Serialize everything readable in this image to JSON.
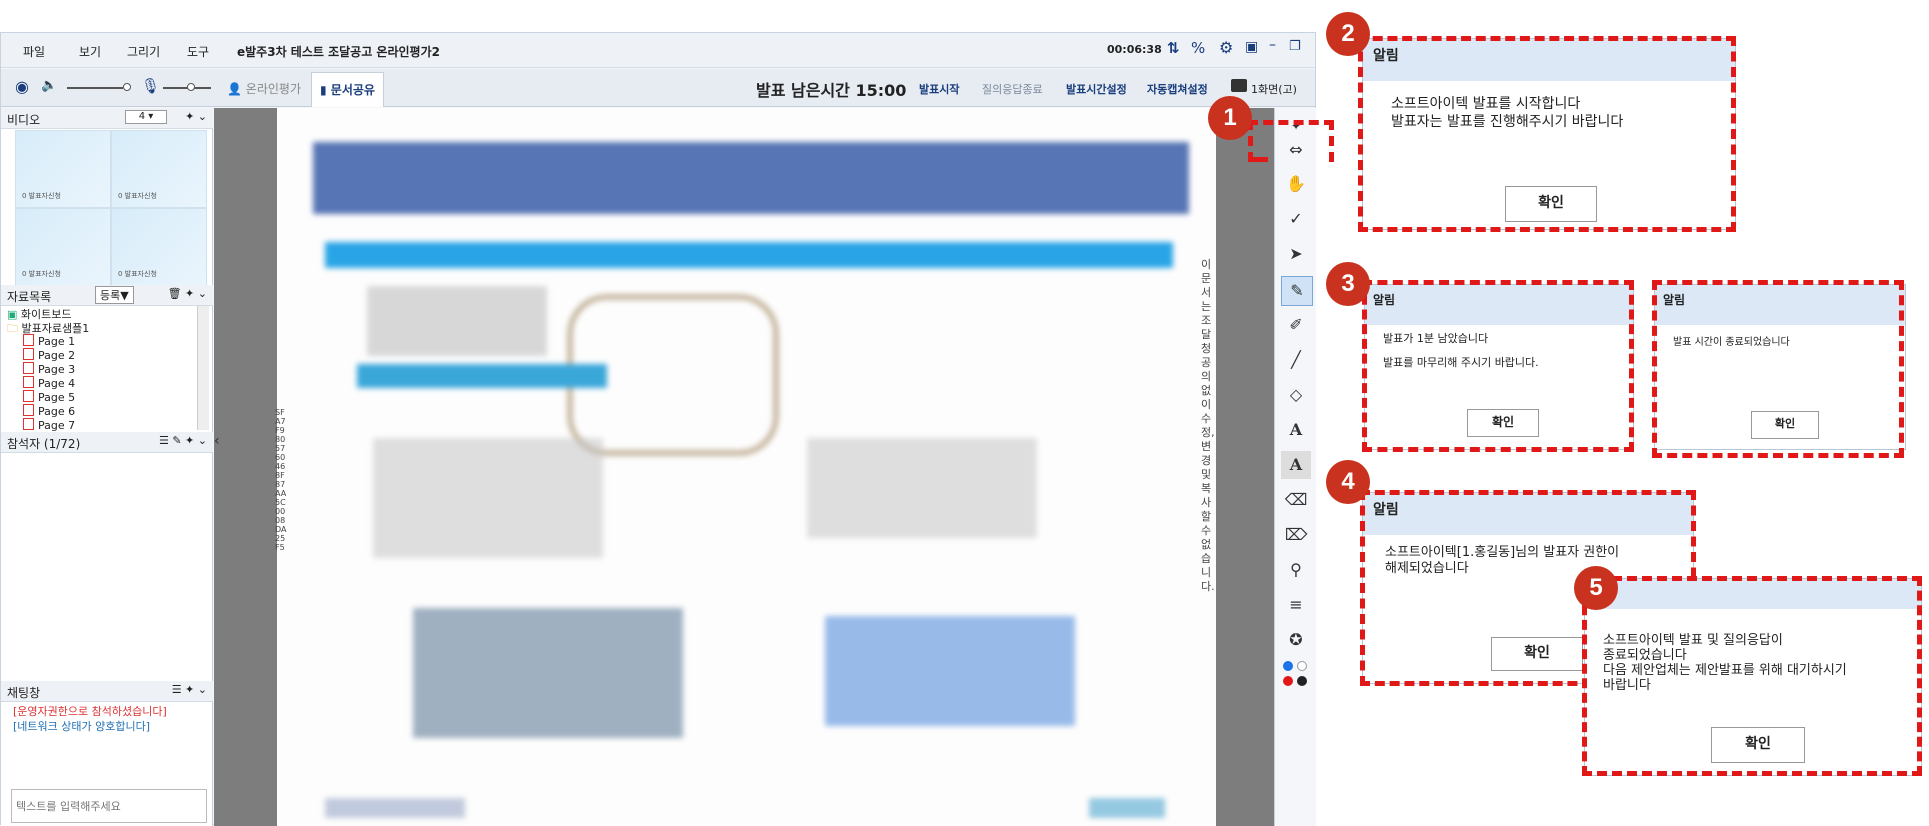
{
  "menu": {
    "file": "파일",
    "view": "보기",
    "draw": "그리기",
    "tools": "도구",
    "title": "e발주3차 테스트 조달공고 온라인평가2",
    "timer": "00:06:38"
  },
  "toolbar": {
    "tab_online": "온라인평가",
    "tab_doc": "문서공유",
    "remaining": "발표 남은시간 15:00",
    "start": "발표시작",
    "qa_end": "질의응답종료",
    "time_setting": "발표시간설정",
    "auto_capture": "자동캡쳐설정",
    "screens": "1화면(고)"
  },
  "left": {
    "video_title": "비디오",
    "video_count": "4",
    "video_cells": [
      "0 발표자신청",
      "0 발표자신청",
      "0 발표자신청",
      "0 발표자신청"
    ],
    "materials_title": "자료목록",
    "register": "등록▼",
    "tree": [
      "화이트보드",
      "발표자료샘플1",
      "Page 1",
      "Page 2",
      "Page 3",
      "Page 4",
      "Page 5",
      "Page 6",
      "Page 7"
    ],
    "participants_title": "참석자 (1/72)",
    "chat_title": "채팅창",
    "chat_lines": [
      "[운영자권한으로 참석하셨습니다]",
      "[네트워크 상태가 양호합니다]"
    ],
    "chat_placeholder": "텍스트를 입력해주세요"
  },
  "doc": {
    "side_code": "SFA7F9805760468F87AA5C0008DA25F5",
    "side_note": "이 문서는 조달청 공의없이 수정, 변경 및 복사할 수 없습니다."
  },
  "popups": [
    {
      "badge": "2",
      "title": "알림",
      "lines": [
        "소프트아이텍 발표를 시작합니다",
        "발표자는 발표를 진행해주시기 바랍니다"
      ],
      "ok": "확인"
    },
    {
      "badge": "3",
      "title": "알림",
      "lines": [
        "발표가 1분 남았습니다",
        "발표를 마무리해 주시기 바랍니다."
      ],
      "ok": "확인"
    },
    {
      "badge": "",
      "title": "알림",
      "lines": [
        "발표 시간이 종료되었습니다"
      ],
      "ok": "확인"
    },
    {
      "badge": "4",
      "title": "알림",
      "lines": [
        "소프트아이텍[1.홍길동]님의 발표자 권한이",
        "해제되었습니다"
      ],
      "ok": "확인"
    },
    {
      "badge": "5",
      "title": "",
      "lines": [
        "소프트아이텍 발표 및 질의응답이",
        "종료되었습니다",
        "다음 제안업체는 제안발표를 위해 대기하시기",
        "바랍니다"
      ],
      "ok": "확인"
    }
  ],
  "badge1": "1",
  "colors": {
    "accent": "#1a3d7c",
    "dash": "#e01818",
    "badge": "#c8321e"
  }
}
